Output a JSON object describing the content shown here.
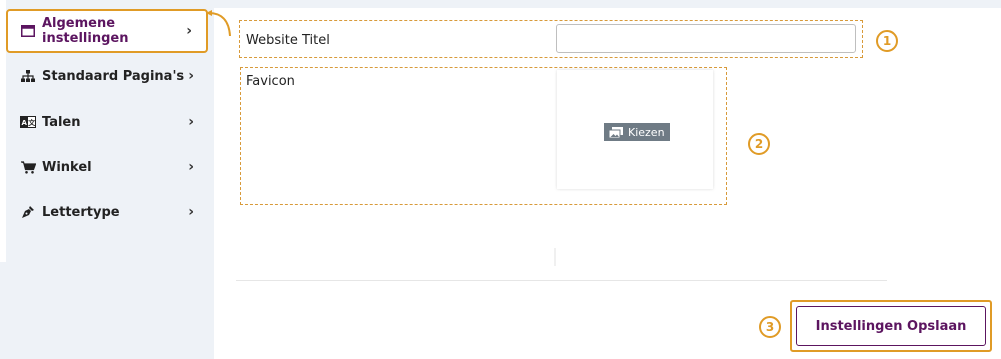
{
  "sidebar": {
    "items": [
      {
        "label": "Algemene instellingen",
        "icon": "window-icon"
      },
      {
        "label": "Standaard Pagina's",
        "icon": "sitemap-icon"
      },
      {
        "label": "Talen",
        "icon": "language-icon"
      },
      {
        "label": "Winkel",
        "icon": "cart-icon"
      },
      {
        "label": "Lettertype",
        "icon": "pen-nib-icon"
      }
    ],
    "chevron": "›"
  },
  "form": {
    "website_title_label": "Website Titel",
    "website_title_value": "",
    "favicon_label": "Favicon",
    "choose_label": "Kiezen",
    "save_label": "Instellingen Opslaan"
  },
  "badges": [
    "1",
    "2",
    "3"
  ],
  "colors": {
    "accent": "#e09b26",
    "brand": "#5c1560",
    "sidebar_bg": "#eef2f7"
  }
}
